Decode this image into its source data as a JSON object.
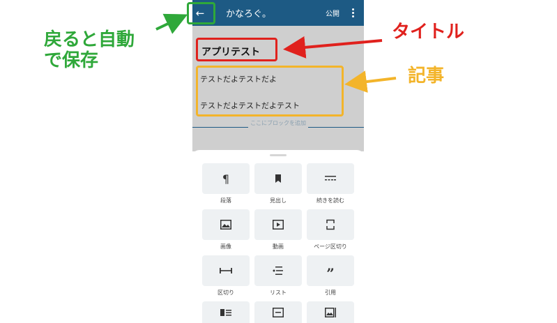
{
  "app_bar": {
    "back_icon": "arrow-left-icon",
    "site_title": "かなろぐ。",
    "publish_label": "公開",
    "more_icon": "more-vertical-icon",
    "color": "#1d5a84"
  },
  "editor": {
    "post_title": "アプリテスト",
    "paragraphs": [
      "テストだよテストだよ",
      "テストだよテストだよテスト"
    ],
    "add_block_hint": "ここにブロックを追加"
  },
  "block_inserter": {
    "blocks": [
      {
        "label": "段落",
        "icon": "paragraph-icon"
      },
      {
        "label": "見出し",
        "icon": "bookmark-icon"
      },
      {
        "label": "続きを読む",
        "icon": "more-icon"
      },
      {
        "label": "画像",
        "icon": "image-icon"
      },
      {
        "label": "動画",
        "icon": "video-icon"
      },
      {
        "label": "ページ区切り",
        "icon": "page-break-icon"
      },
      {
        "label": "区切り",
        "icon": "separator-icon"
      },
      {
        "label": "リスト",
        "icon": "list-icon"
      },
      {
        "label": "引用",
        "icon": "quote-icon"
      },
      {
        "label": "",
        "icon": "media-text-icon"
      },
      {
        "label": "",
        "icon": "gallery-icon"
      },
      {
        "label": "",
        "icon": "cover-icon"
      }
    ]
  },
  "annotations": {
    "back": {
      "text_line1": "戻ると自動",
      "text_line2": "で保存",
      "color": "#2fa83a"
    },
    "title": {
      "text": "タイトル",
      "color": "#e0211d"
    },
    "body": {
      "text": "記事",
      "color": "#f3b42a"
    }
  }
}
